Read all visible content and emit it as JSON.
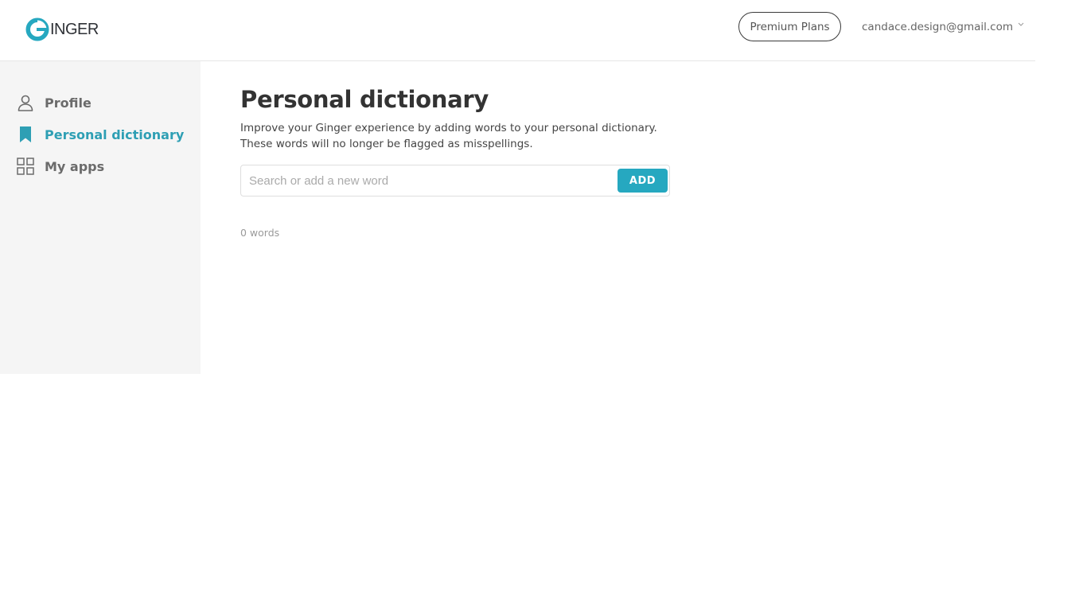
{
  "header": {
    "logo_text": "INGER",
    "premium_label": "Premium Plans",
    "account_email": "candace.design@gmail.com"
  },
  "sidebar": {
    "items": [
      {
        "label": "Profile",
        "icon": "person-icon",
        "active": false
      },
      {
        "label": "Personal dictionary",
        "icon": "bookmark-icon",
        "active": true
      },
      {
        "label": "My apps",
        "icon": "apps-grid-icon",
        "active": false
      }
    ]
  },
  "main": {
    "title": "Personal dictionary",
    "description_line1": "Improve your Ginger experience by adding words to your personal dictionary.",
    "description_line2": "These words will no longer be flagged as misspellings.",
    "search": {
      "placeholder": "Search or add a new word",
      "value": ""
    },
    "add_label": "ADD",
    "word_count": "0 words"
  },
  "colors": {
    "accent": "#26a8c0",
    "active_nav": "#2e9fb4",
    "sidebar_bg": "#f5f5f5"
  }
}
